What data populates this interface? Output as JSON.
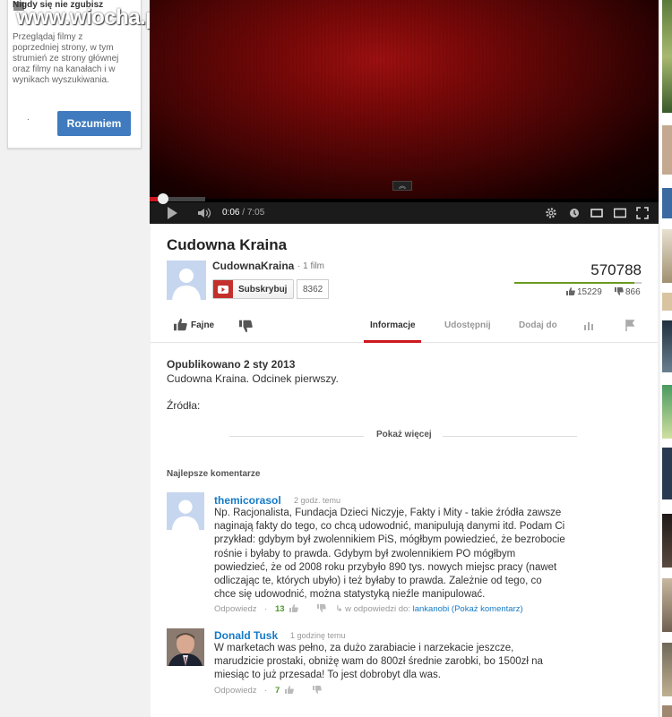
{
  "popup": {
    "title": "Nigdy się nie zgubisz",
    "text": "Przeglądaj filmy z poprzedniej strony, w tym strumień ze strony głównej oraz filmy na kanałach i w wynikach wyszukiwania.",
    "dot": ".",
    "button": "Rozumiem"
  },
  "watermark": "www.wiocha.pl",
  "player": {
    "current_time": "0:06",
    "separator": " / ",
    "duration": "7:05",
    "progress": 0.014
  },
  "video": {
    "title": "Cudowna Kraina",
    "published": "Opublikowano 2 sty 2013",
    "description": "Cudowna Kraina. Odcinek pierwszy.",
    "sources_label": "Źródła:",
    "show_more": "Pokaż więcej",
    "views": "570788",
    "likes": "15229",
    "dislikes": "866",
    "like_ratio": 0.946
  },
  "channel": {
    "name": "CudownaKraina",
    "films": "· 1 film",
    "subscribe_label": "Subskrybuj",
    "subscriber_count": "8362"
  },
  "actions": {
    "like": "Fajne",
    "tabs": [
      "Informacje",
      "Udostępnij",
      "Dodaj do"
    ]
  },
  "comments": {
    "header": "Najlepsze komentarze",
    "items": [
      {
        "author": "themicorasol",
        "time": "2 godz. temu",
        "lines": [
          "Np. Racjonalista, Fundacja Dzieci Niczyje, Fakty i Mity - takie źródła zawsze",
          "naginają fakty do tego, co chcą udowodnić, manipulują danymi itd. Podam Ci",
          "przykład: gdybym był zwolennikiem PiS, mógłbym powiedzieć, że bezrobocie",
          "rośnie i byłaby to prawda. Gdybym był zwolennikiem PO mógłbym",
          "powiedzieć, że od 2008 roku przybyło 890 tys. nowych miejsc pracy (nawet",
          "odliczając te, których ubyło) i też byłaby to prawda. Zależnie od tego, co",
          "chce się udowodnić, można statystyką nieźle manipulować."
        ],
        "reply": "Odpowiedz",
        "count": "13",
        "in_reply_prefix": "w odpowiedzi do:",
        "in_reply_link": "lankanobi (Pokaż komentarz)"
      },
      {
        "author": "Donald Tusk",
        "time": "1 godzinę temu",
        "lines": [
          "W marketach was pełno, za dużo zarabiacie i narzekacie jeszcze,",
          "marudzicie prostaki, obniżę wam do 800zł średnie zarobki, bo 1500zł na",
          "miesiąc to już przesada! To jest dobrobyt dla was."
        ],
        "reply": "Odpowiedz",
        "count": "7"
      }
    ]
  },
  "colors": {
    "accent_red": "#cc181e",
    "link_blue": "#167ac6",
    "button_blue": "#3f7bbe",
    "like_green": "#6a9a1f"
  }
}
